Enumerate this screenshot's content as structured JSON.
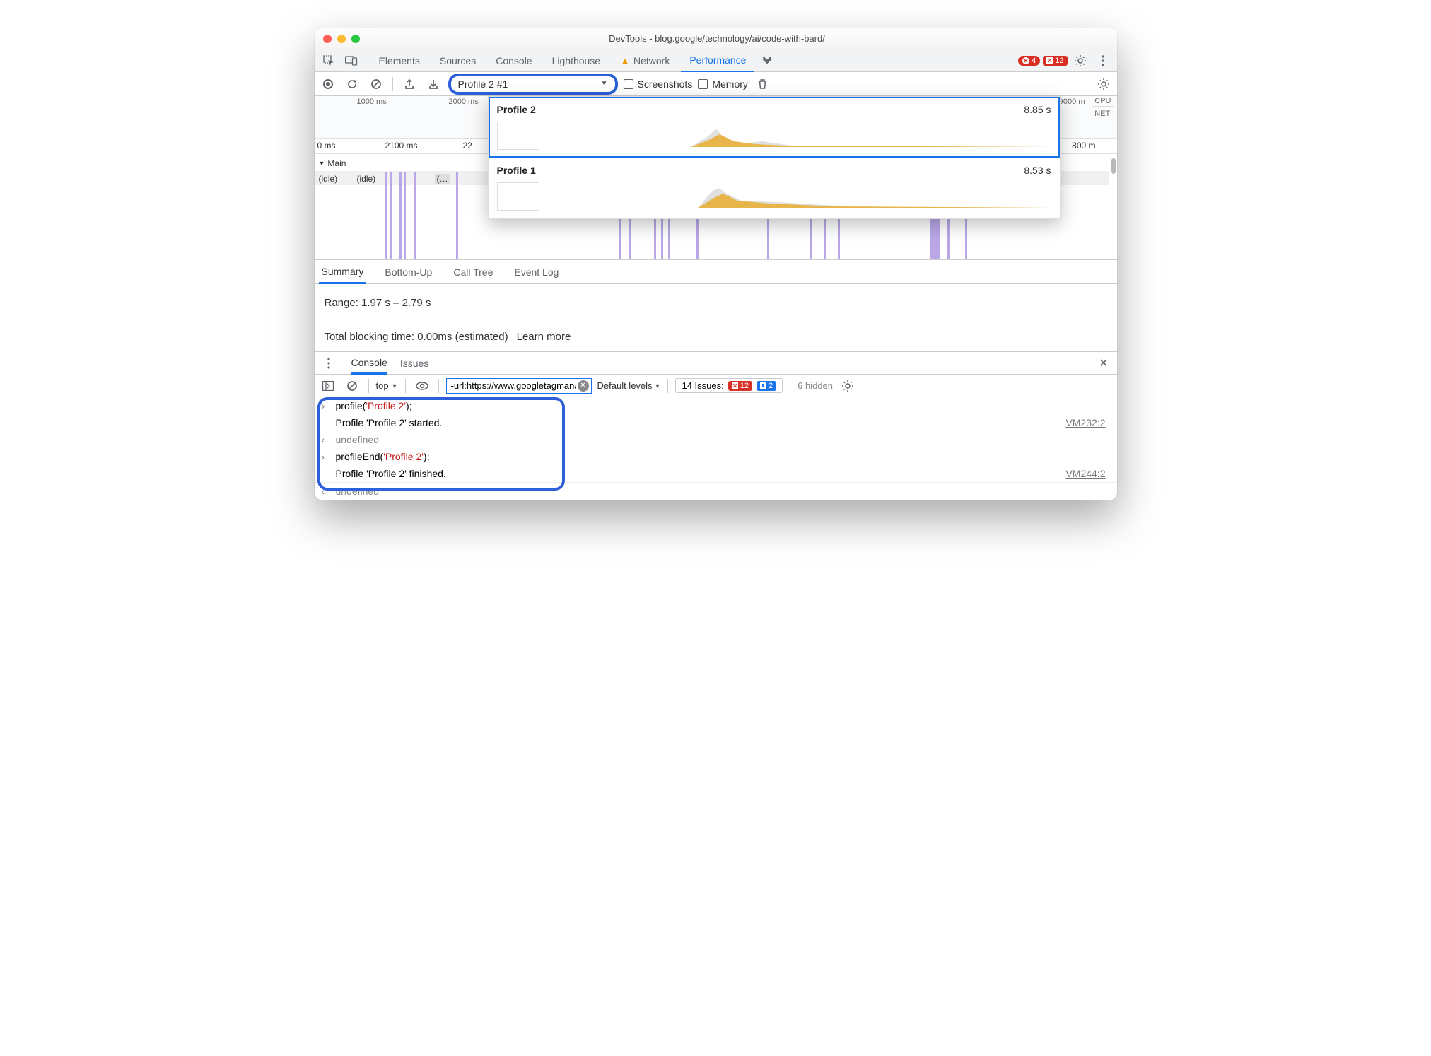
{
  "window": {
    "title": "DevTools - blog.google/technology/ai/code-with-bard/"
  },
  "tabs": {
    "items": [
      "Elements",
      "Sources",
      "Console",
      "Lighthouse",
      "Network",
      "Performance"
    ],
    "active": "Performance",
    "errors_round": "4",
    "errors_square": "12"
  },
  "toolbar": {
    "profile_selected": "Profile 2 #1",
    "screenshots_label": "Screenshots",
    "memory_label": "Memory"
  },
  "dropdown": {
    "items": [
      {
        "name": "Profile 2",
        "time": "8.85 s"
      },
      {
        "name": "Profile 1",
        "time": "8.53 s"
      }
    ]
  },
  "overview": {
    "ticks": [
      "1000 ms",
      "2000 ms",
      "9000 m"
    ],
    "side": [
      "CPU",
      "NET"
    ]
  },
  "ruler": {
    "ticks": [
      {
        "label": "0 ms",
        "pos": 0
      },
      {
        "label": "2100 ms",
        "pos": 100
      },
      {
        "label": "22",
        "pos": 210
      },
      {
        "label": "800 m",
        "pos": 1070
      }
    ]
  },
  "flame": {
    "main_label": "Main",
    "idle1": "(idle)",
    "idle2": "(idle)",
    "trunc": "(…"
  },
  "subtabs": {
    "items": [
      "Summary",
      "Bottom-Up",
      "Call Tree",
      "Event Log"
    ],
    "active": "Summary"
  },
  "summary": {
    "range": "Range: 1.97 s – 2.79 s",
    "blocking": "Total blocking time: 0.00ms (estimated)",
    "learn_more": "Learn more"
  },
  "drawer": {
    "tabs": [
      "Console",
      "Issues"
    ],
    "active": "Console"
  },
  "console_toolbar": {
    "context": "top",
    "filter": "-url:https://www.googletagmanager.c",
    "levels": "Default levels",
    "issues_label": "14 Issues:",
    "issues_err": "12",
    "issues_info": "2",
    "hidden": "6 hidden"
  },
  "console": {
    "lines": [
      {
        "type": "input",
        "pre": "profile(",
        "str": "'Profile 2'",
        "post": ");"
      },
      {
        "type": "log",
        "text": "Profile 'Profile 2' started.",
        "src": "VM232:2"
      },
      {
        "type": "return",
        "text": "undefined"
      },
      {
        "type": "input",
        "pre": "profileEnd(",
        "str": "'Profile 2'",
        "post": ");"
      },
      {
        "type": "log",
        "text": "Profile 'Profile 2' finished.",
        "src": "VM244:2"
      },
      {
        "type": "return",
        "text": "undefined"
      }
    ]
  }
}
